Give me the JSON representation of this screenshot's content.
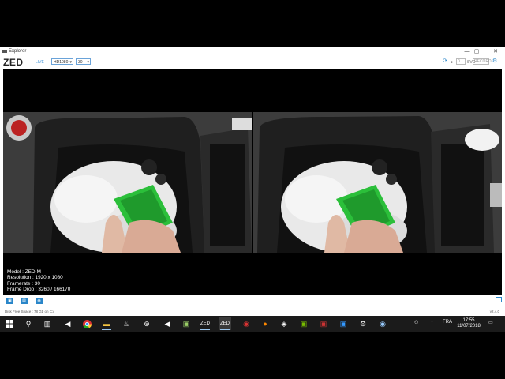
{
  "window": {
    "title": "Explorer",
    "controls": [
      "—",
      "▢",
      "✕"
    ]
  },
  "toolbar": {
    "logo": "ZED",
    "live_label": "LIVE",
    "resolution_value": "HD1080",
    "fps_value": "30",
    "record_box": "0",
    "svo_label": "SVO",
    "svo_box": "RECORD"
  },
  "overlay": {
    "model": "Model : ZED-M",
    "resolution": "Resolution : 1920 x 1080",
    "framerate": "Framerate : 30",
    "frame_drop": "Frame Drop : 3260 / 166170"
  },
  "statusbar": {
    "disk_space": "Disk Free Space : 78 Gb  on C:/",
    "version": "v2.4.0"
  },
  "taskbar": {
    "language": "FRA",
    "time": "17:55",
    "date": "11/07/2018"
  },
  "colors": {
    "accent": "#2a86c9",
    "taskbar": "#1b1b1b",
    "sponge": "#2bbf3a"
  }
}
